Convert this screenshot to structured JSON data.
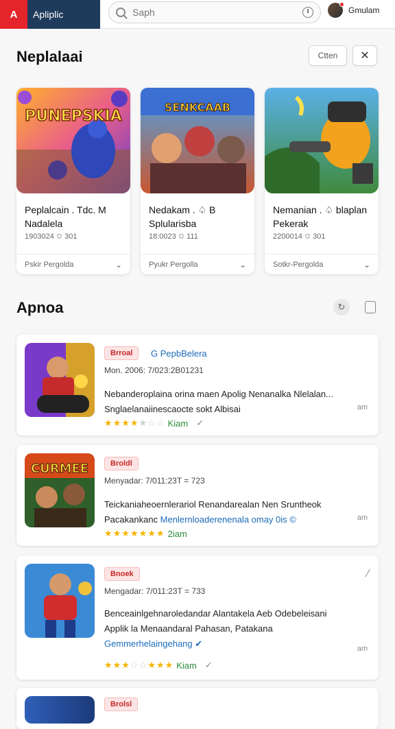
{
  "header": {
    "logo_text": "A",
    "app_name": "Apliplic",
    "search_placeholder": "Saph",
    "user_name": "Gmulam"
  },
  "featured": {
    "title": "Neplalaai",
    "button_label": "Ctten",
    "close_label": "✕",
    "cards": [
      {
        "title": "Peplalcain . Tdc. M Nadalela",
        "meta": "1903024 ✩ 301",
        "footer": "Pskir Pergolda",
        "art_text": "PUNEPSKIA"
      },
      {
        "title": "Nedakam . ♤ B Splularisba",
        "meta": "18:0023 ✩ 111",
        "footer": "Pyukr Pergolla",
        "art_text": "SENKCAAB"
      },
      {
        "title": "Nemanian . ♤ blaplan Pekerak",
        "meta": "2200014 ✩ 301",
        "footer": "Sotkr-Pergolda",
        "art_text": ""
      }
    ]
  },
  "list_section": {
    "title": "Apnoa",
    "items": [
      {
        "badge": "Brroal",
        "category": "G PepbBelera",
        "date": "Mon. 2006: 7/023:2B01231",
        "desc_lines": [
          "Nebanderoplaina orina maen Apolig Nenanalka Nlelalan...",
          "Snglaelanaiinescaocte sokt Albisai"
        ],
        "rating_label": "Kiam",
        "stars_on": 4,
        "stars_total": 7,
        "side": "am",
        "art_text": ""
      },
      {
        "badge": "Broldl",
        "category": "",
        "date": "Menyadar: 7/011:23T = 723",
        "desc_lines": [
          "Teickaniaheoernlerariol Renandarealan Nen Sruntheok"
        ],
        "desc_plain": "Pacakankanc ",
        "desc_link": "Menlernloaderenenala omay 0is ©",
        "rating_label": "2iam",
        "stars_on": 7,
        "stars_total": 7,
        "side": "am",
        "art_text": "CURMEE"
      },
      {
        "badge": "Bnoek",
        "category": "",
        "date": "Mengadar: 7/011:23T = 733",
        "desc_lines": [
          "Benceainlgehnaroledandar Alantakela Aeb Odebeleisani",
          "Applik la Menaandaral Pahasan, Patakana"
        ],
        "desc_link_line": "Gemmerhelaingehang ✔",
        "rating_label": "Kiam",
        "stars_on": 3,
        "stars_total": 8,
        "side": "am",
        "art_text": ""
      },
      {
        "badge": "Brolsl",
        "category": "",
        "date": "",
        "desc_lines": [],
        "rating_label": "",
        "stars_on": 0,
        "stars_total": 0,
        "side": "",
        "art_text": ""
      }
    ]
  },
  "colors": {
    "brand_bg": "#1f3b5c",
    "brand_red": "#e4262c",
    "link_blue": "#1c6bb8",
    "star": "#f5b400",
    "badge_bg": "#fde4e4"
  }
}
